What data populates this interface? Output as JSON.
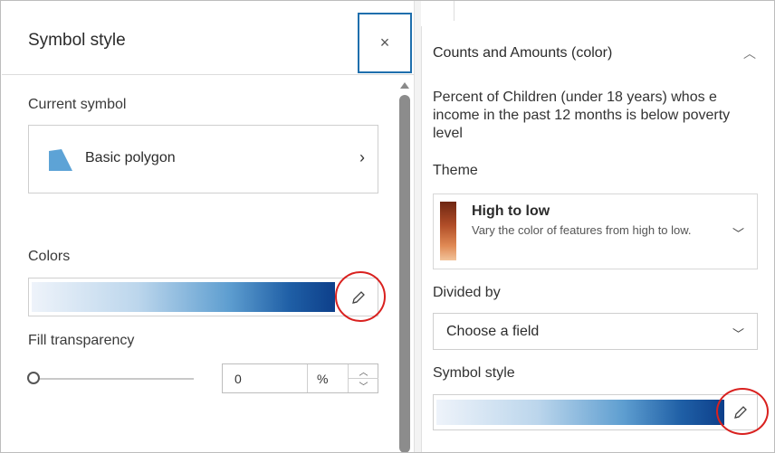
{
  "symbol_style_panel": {
    "title": "Symbol style",
    "close_label": "×",
    "current_symbol_label": "Current symbol",
    "current_symbol_name": "Basic polygon",
    "current_symbol_chevron": "›",
    "colors_label": "Colors",
    "fill_transparency_label": "Fill transparency",
    "transparency_value": "0",
    "transparency_unit": "%",
    "transparency_slider_level": 0,
    "ramp_colors": [
      "#eef3fa",
      "#bcd6ec",
      "#5e9ed0",
      "#1f5fa6",
      "#0d3f8a"
    ]
  },
  "style_options_panel": {
    "section_title": "Counts and Amounts (color)",
    "attribute_description": "Percent of Children (under 18 years) whos e income in the past 12 months is below poverty level",
    "theme_label": "Theme",
    "theme_name": "High to low",
    "theme_description": "Vary the color of features from high to low.",
    "theme_colors": [
      "#6e2612",
      "#b14d28",
      "#e08a54",
      "#f2c39a"
    ],
    "divided_by_label": "Divided by",
    "divided_by_value": "Choose a field",
    "symbol_style_label": "Symbol style"
  },
  "colors": {
    "accent_border": "#1f6fad",
    "highlight_circle": "#d9211f"
  },
  "icons": {
    "close": "close-icon",
    "polygon": "polygon-icon",
    "pencil": "pencil-icon",
    "chevron_right": "chevron-right-icon",
    "chevron_down": "chevron-down-icon",
    "chevron_up": "chevron-up-icon"
  }
}
